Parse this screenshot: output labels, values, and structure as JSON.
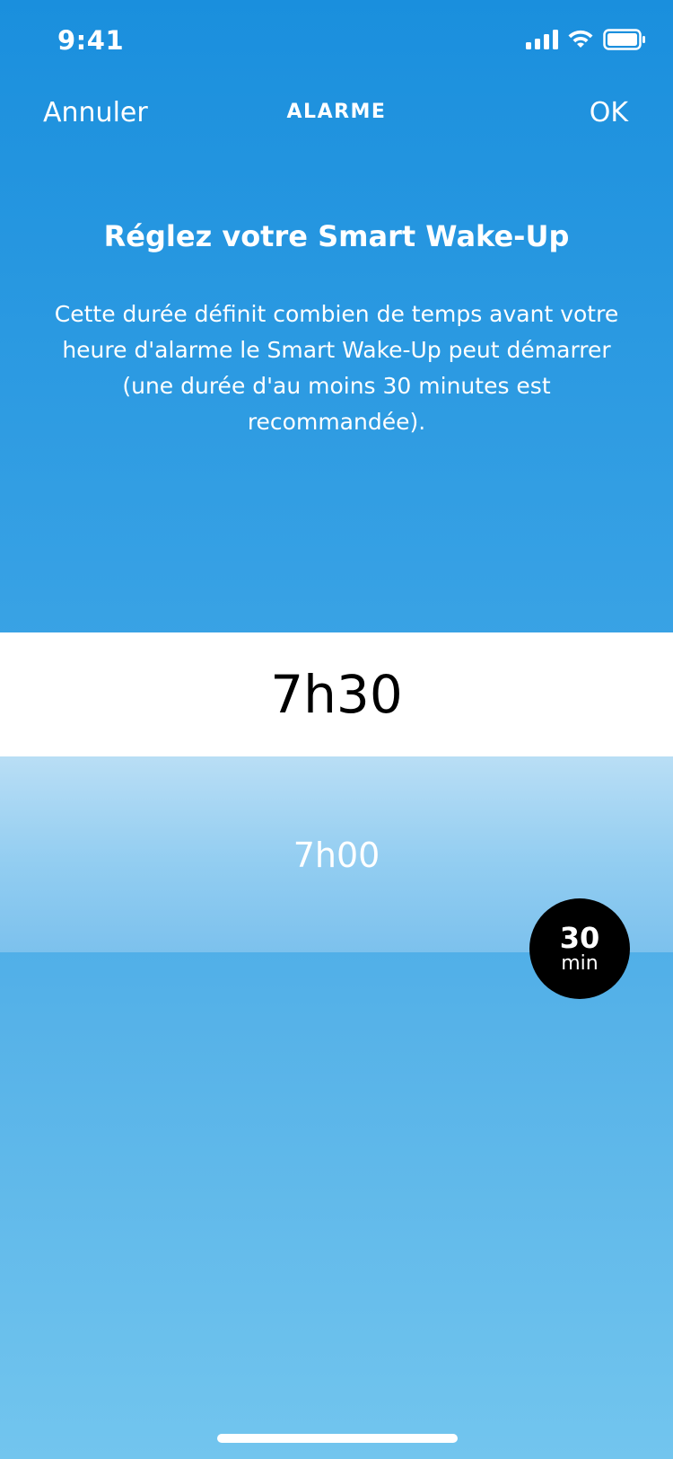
{
  "status_bar": {
    "time": "9:41",
    "icons": [
      "signal-icon",
      "wifi-icon",
      "battery-icon"
    ]
  },
  "nav": {
    "cancel_label": "Annuler",
    "title": "ALARME",
    "ok_label": "OK"
  },
  "content": {
    "heading": "Réglez votre Smart Wake-Up",
    "description": "Cette durée définit combien de temps avant votre heure d'alarme le Smart Wake-Up peut démarrer (une durée d'au moins 30 minutes est recommandée)."
  },
  "picker": {
    "selected_time": "7h30",
    "next_time": "7h00"
  },
  "badge": {
    "value": "30",
    "unit": "min"
  },
  "colors": {
    "background_top": "#1a8fdd",
    "background_bottom": "#72c5ee",
    "badge_background": "#000000",
    "selected_row": "#ffffff"
  }
}
